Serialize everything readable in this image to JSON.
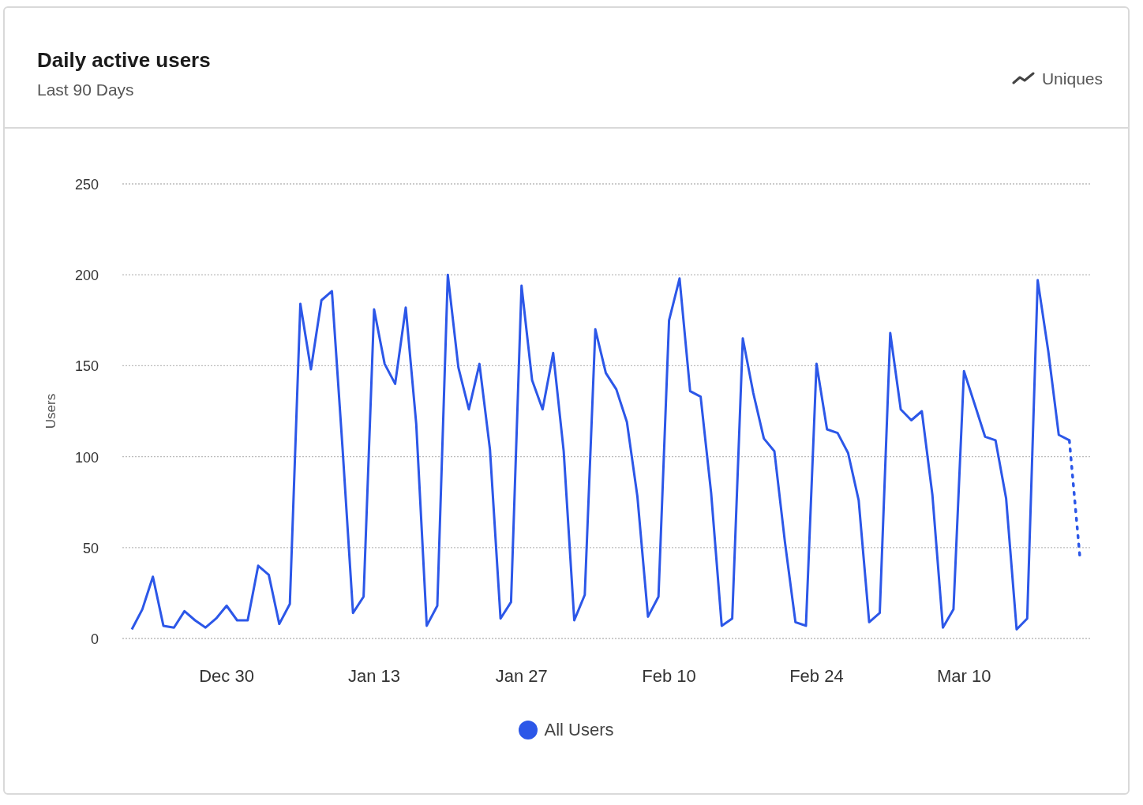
{
  "card": {
    "title": "Daily active users",
    "subtitle": "Last 90 Days",
    "metric": "Uniques",
    "chart_data": {
      "type": "line",
      "ylabel": "Users",
      "categories": [
        null,
        null,
        null,
        null,
        null,
        null,
        null,
        null,
        null,
        "Dec 30",
        null,
        null,
        null,
        null,
        null,
        null,
        null,
        null,
        null,
        null,
        null,
        null,
        null,
        "Jan 13",
        null,
        null,
        null,
        null,
        null,
        null,
        null,
        null,
        null,
        null,
        null,
        null,
        null,
        "Jan 27",
        null,
        null,
        null,
        null,
        null,
        null,
        null,
        null,
        null,
        null,
        null,
        null,
        null,
        "Feb 10",
        null,
        null,
        null,
        null,
        null,
        null,
        null,
        null,
        null,
        null,
        null,
        null,
        null,
        "Feb 24",
        null,
        null,
        null,
        null,
        null,
        null,
        null,
        null,
        null,
        null,
        null,
        null,
        null,
        "Mar 10",
        null,
        null,
        null,
        null,
        null,
        null,
        null,
        null,
        null,
        null,
        null
      ],
      "series": [
        {
          "name": "All Users",
          "color": "#2c57e8",
          "values": [
            5,
            16,
            34,
            7,
            6,
            15,
            10,
            6,
            11,
            18,
            10,
            10,
            40,
            35,
            8,
            19,
            184,
            148,
            186,
            191,
            105,
            14,
            23,
            181,
            151,
            140,
            182,
            118,
            7,
            18,
            200,
            149,
            126,
            151,
            104,
            11,
            20,
            194,
            142,
            126,
            157,
            103,
            10,
            24,
            170,
            146,
            137,
            119,
            78,
            12,
            23,
            175,
            198,
            136,
            133,
            80,
            7,
            11,
            165,
            135,
            110,
            103,
            53,
            9,
            7,
            151,
            115,
            113,
            102,
            76,
            9,
            14,
            168,
            126,
            120,
            125,
            79,
            6,
            16,
            147,
            129,
            111,
            109,
            77,
            5,
            11,
            197,
            158,
            112,
            109,
            45
          ]
        }
      ],
      "ylim": [
        0,
        250
      ],
      "yticks": [
        0,
        50,
        100,
        150,
        200,
        250
      ],
      "grid": true
    }
  }
}
